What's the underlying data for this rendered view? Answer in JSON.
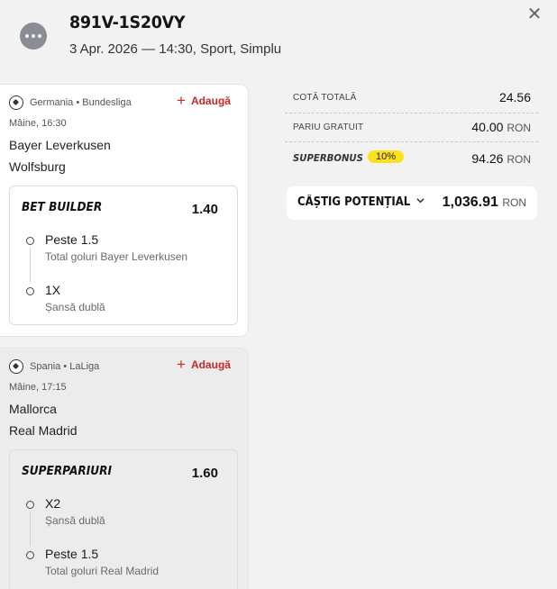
{
  "header": {
    "ticket_id": "891V-1S20VY",
    "subtitle": "3 Apr. 2026 — 14:30, Sport, Simplu"
  },
  "bets": [
    {
      "league": "Germania • Bundesliga",
      "add_label": "Adaugă",
      "time": "Mâine, 16:30",
      "home": "Bayer Leverkusen",
      "away": "Wolfsburg",
      "group_title": "BET BUILDER",
      "group_odd": "1.40",
      "selections": [
        {
          "name": "Peste 1.5",
          "desc": "Total goluri Bayer Leverkusen"
        },
        {
          "name": "1X",
          "desc": "Șansă dublă"
        }
      ]
    },
    {
      "league": "Spania • LaLiga",
      "add_label": "Adaugă",
      "time": "Mâine, 17:15",
      "home": "Mallorca",
      "away": "Real Madrid",
      "group_title": "SUPERPARIURI",
      "group_odd": "1.60",
      "selections": [
        {
          "name": "X2",
          "desc": "Șansă dublă"
        },
        {
          "name": "Peste 1.5",
          "desc": "Total goluri Real Madrid"
        }
      ]
    }
  ],
  "summary": {
    "total_odds_label": "COTĂ TOTALĂ",
    "total_odds": "24.56",
    "free_bet_label": "PARIU GRATUIT",
    "free_bet": "40.00",
    "superbonus_label": "SUPERBONUS",
    "superbonus_pct": "10%",
    "superbonus_value": "94.26",
    "win_label": "CÂȘTIG POTENȚIAL",
    "win_value": "1,036.91",
    "currency": "RON"
  },
  "colors": {
    "accent_red": "#c62828",
    "badge_yellow": "#fbe21b"
  },
  "icons": {
    "more": "more-horizontal-icon",
    "close": "close-icon",
    "sport": "soccer-ball-icon",
    "add": "plus-icon",
    "expand": "chevron-down-icon"
  }
}
